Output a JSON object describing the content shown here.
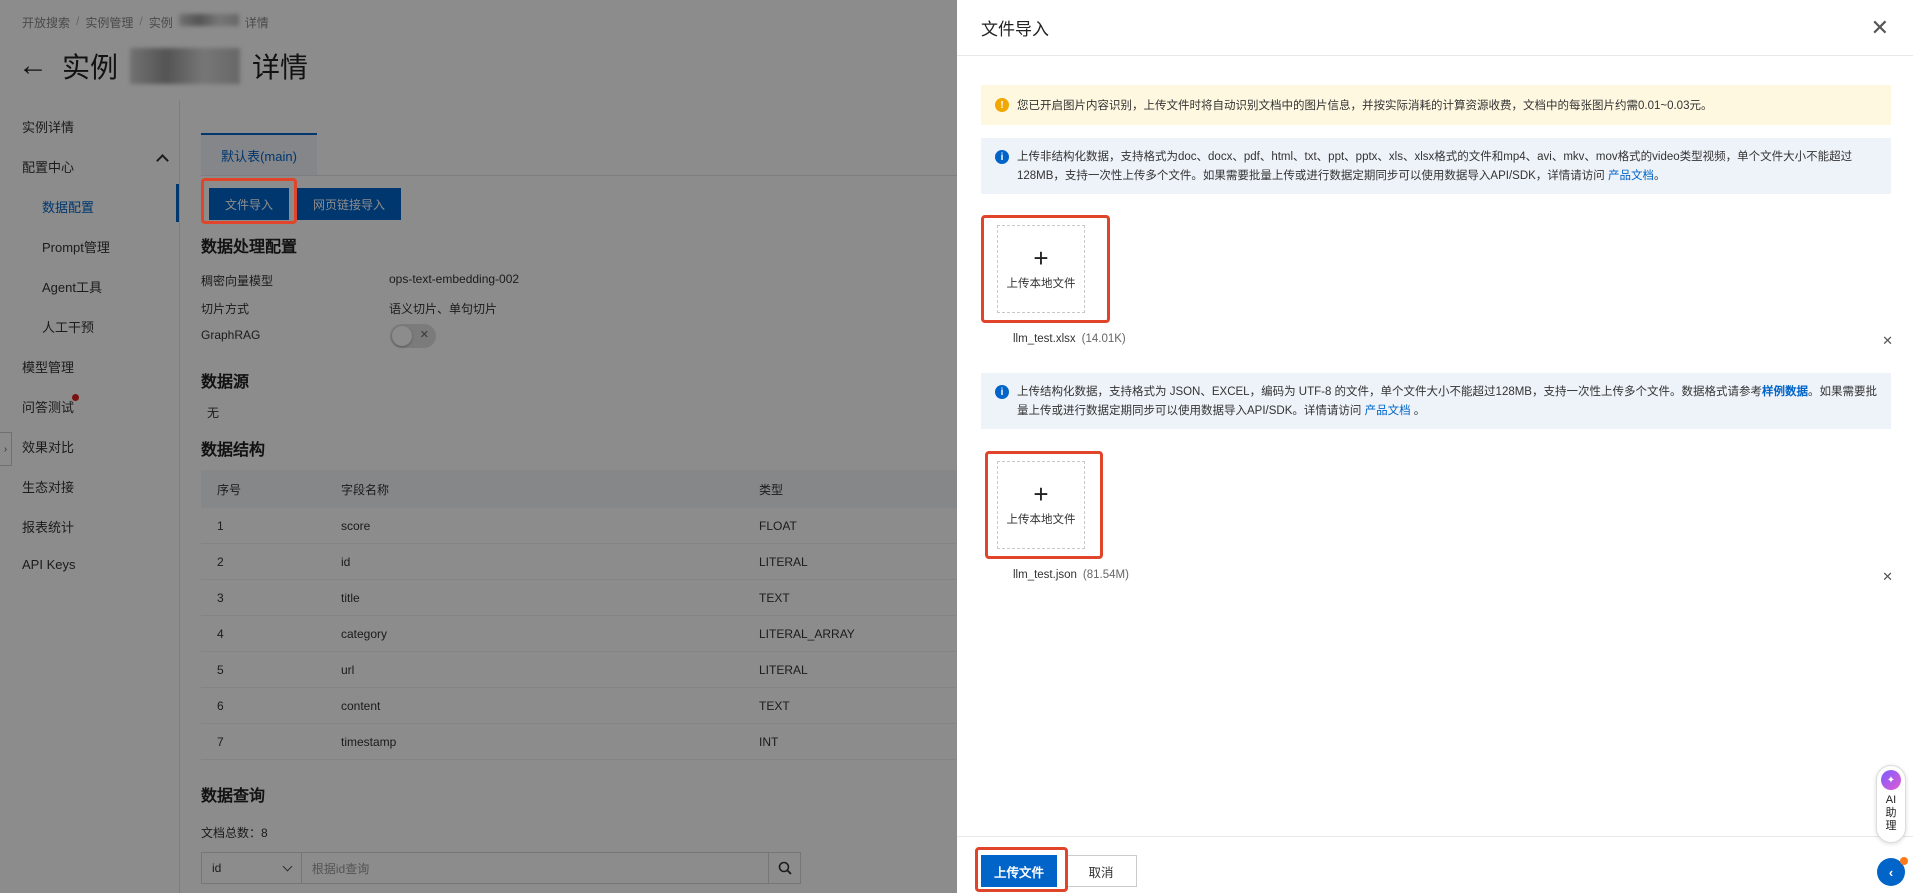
{
  "breadcrumb": [
    "开放搜索",
    "实例管理",
    "实例",
    "详情"
  ],
  "page": {
    "title_prefix": "实例",
    "title_suffix": "详情"
  },
  "sidebar": {
    "items": [
      {
        "label": "实例详情"
      },
      {
        "label": "配置中心"
      },
      {
        "label": "数据配置"
      },
      {
        "label": "Prompt管理"
      },
      {
        "label": "Agent工具"
      },
      {
        "label": "人工干预"
      },
      {
        "label": "模型管理"
      },
      {
        "label": "问答测试"
      },
      {
        "label": "效果对比"
      },
      {
        "label": "生态对接"
      },
      {
        "label": "报表统计"
      },
      {
        "label": "API Keys"
      }
    ]
  },
  "main": {
    "tab": "默认表(main)",
    "import_file_btn": "文件导入",
    "import_url_btn": "网页链接导入",
    "processing": {
      "title": "数据处理配置",
      "rows": [
        {
          "label": "稠密向量模型",
          "value": "ops-text-embedding-002"
        },
        {
          "label": "切片方式",
          "value": "语义切片、单句切片"
        },
        {
          "label": "GraphRAG",
          "value": ""
        }
      ]
    },
    "datasource": {
      "title": "数据源",
      "value": "无"
    },
    "schema": {
      "title": "数据结构",
      "headers": [
        "序号",
        "字段名称",
        "类型"
      ],
      "rows": [
        [
          "1",
          "score",
          "FLOAT"
        ],
        [
          "2",
          "id",
          "LITERAL"
        ],
        [
          "3",
          "title",
          "TEXT"
        ],
        [
          "4",
          "category",
          "LITERAL_ARRAY"
        ],
        [
          "5",
          "url",
          "LITERAL"
        ],
        [
          "6",
          "content",
          "TEXT"
        ],
        [
          "7",
          "timestamp",
          "INT"
        ]
      ]
    },
    "query": {
      "title": "数据查询",
      "doc_count": "文档总数：8",
      "select_value": "id",
      "placeholder": "根据id查询"
    }
  },
  "drawer": {
    "title": "文件导入",
    "warn_notice": "您已开启图片内容识别，上传文件时将自动识别文档中的图片信息，并按实际消耗的计算资源收费，文档中的每张图片约需0.01~0.03元。",
    "unstructured_notice": "上传非结构化数据，支持格式为doc、docx、pdf、html、txt、ppt、pptx、xls、xlsx格式的文件和mp4、avi、mkv、mov格式的video类型视频，单个文件大小不能超过128MB，支持一次性上传多个文件。如果需要批量上传或进行数据定期同步可以使用数据导入API/SDK，详情请访问",
    "unstructured_link": "产品文档",
    "structured_notice_a": "上传结构化数据，支持格式为 JSON、EXCEL，编码为 UTF-8 的文件，单个文件大小不能超过128MB，支持一次性上传多个文件。数据格式请参考",
    "structured_sample_link": "样例数据",
    "structured_notice_b": "。如果需要批量上传或进行数据定期同步可以使用数据导入API/SDK。详情请访问",
    "structured_link": "产品文档",
    "upload_local_label": "上传本地文件",
    "files_unstructured": [
      {
        "name": "llm_test.xlsx",
        "size": "(14.01K)"
      }
    ],
    "files_structured": [
      {
        "name": "llm_test.json",
        "size": "(81.54M)"
      }
    ],
    "submit": "上传文件",
    "cancel": "取消"
  },
  "assistant": {
    "label_1": "AI",
    "label_2": "助",
    "label_3": "理"
  },
  "colors": {
    "primary": "#0064c8",
    "highlight": "#e0452b",
    "warn_bg": "#fff8e1",
    "info_bg": "#eef3f9"
  }
}
